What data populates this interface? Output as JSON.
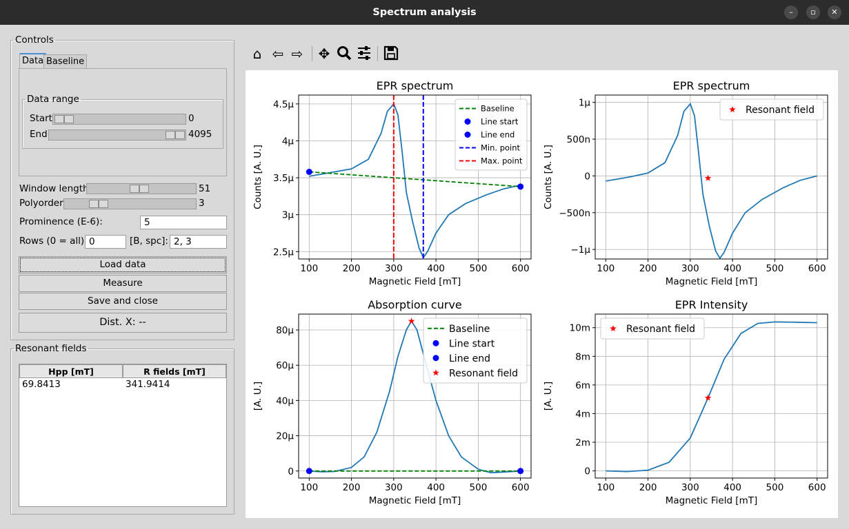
{
  "window": {
    "title": "Spectrum analysis",
    "minimize": "–",
    "maximize": "▫",
    "close": "✕"
  },
  "controls": {
    "legend": "Controls",
    "tabs": [
      "Data",
      "Baseline"
    ],
    "data_range_legend": "Data range",
    "start_label": "Start",
    "start_value": "0",
    "end_label": "End",
    "end_value": "4095",
    "window_length_label": "Window length",
    "window_length_value": "51",
    "polyorder_label": "Polyorder",
    "polyorder_value": "3",
    "prominence_label": "Prominence (E-6):",
    "prominence_value": "5",
    "rows_label": "Rows (0 = all):",
    "rows_value": "0",
    "bspc_label": "[B, spc]:",
    "bspc_value": "2, 3",
    "load_label": "Load data",
    "measure_label": "Measure",
    "save_label": "Save and close",
    "dist_label": "Dist. X: --"
  },
  "resonant": {
    "legend": "Resonant fields",
    "columns": [
      "Hpp [mT]",
      "R fields [mT]"
    ],
    "rows": [
      [
        "69.8413",
        "341.9414"
      ]
    ]
  },
  "toolbar": {
    "icons": [
      "home-icon",
      "back-arrow-icon",
      "forward-arrow-icon",
      "pan-icon",
      "zoom-icon",
      "configure-icon",
      "save-icon"
    ]
  },
  "chart_data": [
    {
      "type": "line",
      "title": "EPR spectrum",
      "xlabel": "Magnetic Field [mT]",
      "ylabel": "Counts [A. U.]",
      "xlim": [
        75,
        625
      ],
      "ylim": [
        2.4,
        4.62
      ],
      "xticks": [
        100,
        200,
        300,
        400,
        500,
        600
      ],
      "xtick_labels": [
        "100",
        "200",
        "300",
        "400",
        "500",
        "600"
      ],
      "yticks": [
        2.5,
        3,
        3.5,
        4,
        4.5
      ],
      "ytick_labels": [
        "2.5μ",
        "3μ",
        "3.5μ",
        "4μ",
        "4.5μ"
      ],
      "grid": true,
      "series": [
        {
          "x": [
            100,
            130,
            160,
            200,
            240,
            270,
            285,
            300,
            310,
            320,
            330,
            345,
            360,
            370,
            380,
            400,
            430,
            470,
            520,
            560,
            600
          ],
          "y": [
            3.52,
            3.55,
            3.58,
            3.62,
            3.75,
            4.1,
            4.4,
            4.5,
            4.35,
            3.85,
            3.3,
            2.9,
            2.55,
            2.42,
            2.5,
            2.75,
            3.0,
            3.15,
            3.27,
            3.35,
            3.4
          ],
          "color": "#1f77b4"
        },
        {
          "name": "Baseline",
          "x": [
            100,
            600
          ],
          "y": [
            3.58,
            3.38
          ],
          "color": "#008000",
          "dash": true
        },
        {
          "name": "Line start",
          "x": [
            100
          ],
          "y": [
            3.58
          ],
          "color": "#0000ff",
          "marker": "circle"
        },
        {
          "name": "Line end",
          "x": [
            600
          ],
          "y": [
            3.38
          ],
          "color": "#0000ff",
          "marker": "circle"
        },
        {
          "name": "Min. point",
          "vline": 370,
          "color": "#0000ff"
        },
        {
          "name": "Max. point",
          "vline": 300,
          "color": "#ff0000"
        }
      ],
      "legend_loc": "upper right"
    },
    {
      "type": "line",
      "title": "EPR spectrum",
      "xlabel": "Magnetic Field [mT]",
      "ylabel": "Counts [A. U.]",
      "xlim": [
        75,
        625
      ],
      "ylim": [
        -1.13,
        1.1
      ],
      "xticks": [
        100,
        200,
        300,
        400,
        500,
        600
      ],
      "xtick_labels": [
        "100",
        "200",
        "300",
        "400",
        "500",
        "600"
      ],
      "yticks": [
        -1,
        -0.5,
        0,
        0.5,
        1
      ],
      "ytick_labels": [
        "−1μ",
        "−500n",
        "0",
        "500n",
        "1μ"
      ],
      "grid": true,
      "series": [
        {
          "x": [
            100,
            130,
            160,
            200,
            240,
            270,
            285,
            300,
            310,
            320,
            330,
            345,
            360,
            370,
            380,
            400,
            430,
            470,
            520,
            560,
            600
          ],
          "y": [
            -0.07,
            -0.04,
            -0.01,
            0.04,
            0.18,
            0.55,
            0.88,
            0.98,
            0.82,
            0.3,
            -0.25,
            -0.68,
            -1.02,
            -1.12,
            -1.04,
            -0.78,
            -0.5,
            -0.32,
            -0.16,
            -0.06,
            0.0
          ],
          "color": "#1f77b4"
        },
        {
          "name": "Resonant field",
          "x": [
            342
          ],
          "y": [
            -0.03
          ],
          "color": "#ff0000",
          "marker": "star"
        }
      ],
      "legend_loc": "upper right"
    },
    {
      "type": "line",
      "title": "Absorption curve",
      "xlabel": "Magnetic Field [mT]",
      "ylabel": "[A. U.]",
      "xlim": [
        75,
        625
      ],
      "ylim": [
        -4,
        89
      ],
      "xticks": [
        100,
        200,
        300,
        400,
        500,
        600
      ],
      "xtick_labels": [
        "100",
        "200",
        "300",
        "400",
        "500",
        "600"
      ],
      "yticks": [
        0,
        20,
        40,
        60,
        80
      ],
      "ytick_labels": [
        "0",
        "20μ",
        "40μ",
        "60μ",
        "80μ"
      ],
      "grid": true,
      "series": [
        {
          "x": [
            100,
            130,
            160,
            200,
            230,
            260,
            290,
            310,
            330,
            342,
            355,
            375,
            400,
            430,
            460,
            500,
            530,
            560,
            600
          ],
          "y": [
            0,
            -0.5,
            -0.3,
            2,
            8,
            22,
            45,
            65,
            80,
            85,
            80,
            62,
            40,
            20,
            8,
            1,
            -1,
            -0.6,
            0
          ],
          "color": "#1f77b4"
        },
        {
          "name": "Baseline",
          "x": [
            100,
            600
          ],
          "y": [
            0,
            0
          ],
          "color": "#008000",
          "dash": true
        },
        {
          "name": "Line start",
          "x": [
            100
          ],
          "y": [
            0
          ],
          "color": "#0000ff",
          "marker": "circle"
        },
        {
          "name": "Line end",
          "x": [
            600
          ],
          "y": [
            0
          ],
          "color": "#0000ff",
          "marker": "circle"
        },
        {
          "name": "Resonant field",
          "x": [
            342
          ],
          "y": [
            85
          ],
          "color": "#ff0000",
          "marker": "star"
        }
      ],
      "legend_loc": "upper right"
    },
    {
      "type": "line",
      "title": "EPR Intensity",
      "xlabel": "Magnetic Field [mT]",
      "ylabel": "[A. U.]",
      "xlim": [
        75,
        625
      ],
      "ylim": [
        -0.5,
        10.95
      ],
      "xticks": [
        100,
        200,
        300,
        400,
        500,
        600
      ],
      "xtick_labels": [
        "100",
        "200",
        "300",
        "400",
        "500",
        "600"
      ],
      "yticks": [
        0,
        2,
        4,
        6,
        8,
        10
      ],
      "ytick_labels": [
        "0",
        "2m",
        "4m",
        "6m",
        "8m",
        "10m"
      ],
      "grid": true,
      "series": [
        {
          "x": [
            100,
            150,
            200,
            250,
            300,
            342,
            380,
            420,
            460,
            500,
            550,
            600
          ],
          "y": [
            0,
            -0.05,
            0.05,
            0.6,
            2.3,
            5.1,
            7.8,
            9.6,
            10.3,
            10.4,
            10.38,
            10.35
          ],
          "color": "#1f77b4"
        },
        {
          "name": "Resonant field",
          "x": [
            342
          ],
          "y": [
            5.1
          ],
          "color": "#ff0000",
          "marker": "star"
        }
      ],
      "legend_loc": "upper left"
    }
  ]
}
